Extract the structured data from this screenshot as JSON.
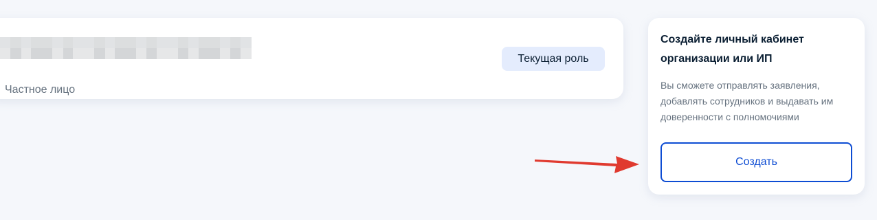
{
  "profile_card": {
    "type_label": "Частное лицо",
    "role_badge": "Текущая роль"
  },
  "create_card": {
    "title": "Создайте личный кабинет организации или ИП",
    "description": "Вы сможете отправлять заявления, добавлять сотрудников и выдавать им доверенности с полномочиями",
    "button_label": "Создать"
  },
  "colors": {
    "page_background": "#f5f7fb",
    "card_background": "#ffffff",
    "accent": "#0d4cd3",
    "badge_background": "#e4ecfd",
    "muted_text": "#66727f",
    "annotation_arrow": "#e03a2f"
  },
  "icons": {
    "annotation": "arrow-right-icon"
  }
}
